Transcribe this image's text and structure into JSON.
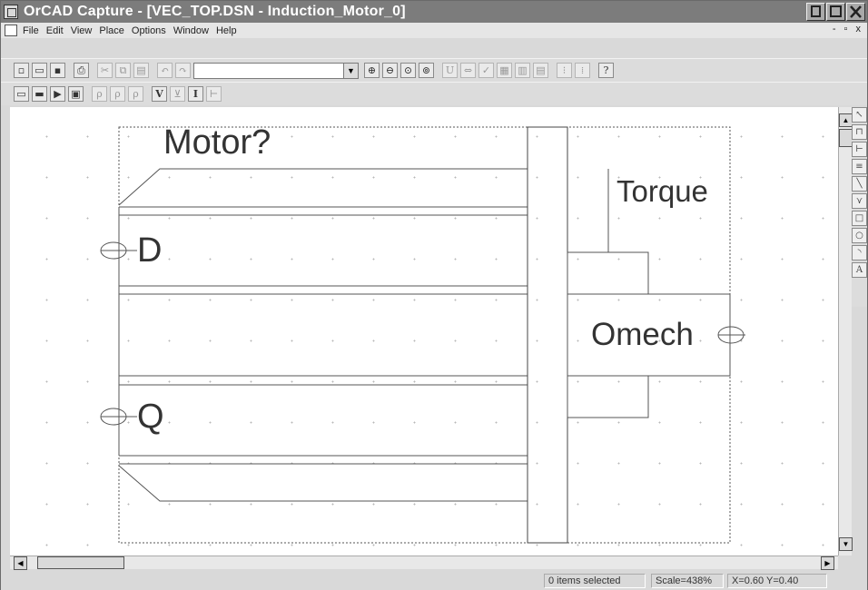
{
  "window": {
    "title": "OrCAD Capture - [VEC_TOP.DSN - Induction_Motor_0]",
    "mdi_controls": "- ▫ x"
  },
  "menu": {
    "items": [
      "File",
      "Edit",
      "View",
      "Place",
      "Options",
      "Window",
      "Help"
    ]
  },
  "toolbar1": {
    "combo_value": "",
    "icons": [
      "new-icon",
      "open-icon",
      "save-icon",
      "print-icon",
      "cut-icon",
      "copy-icon",
      "paste-icon",
      "undo-icon",
      "redo-icon",
      "zoom-in-icon",
      "zoom-out-icon",
      "zoom-area-icon",
      "zoom-all-icon",
      "annotate-icon",
      "cross-ref-icon",
      "drc-icon",
      "netlist-icon",
      "bom-icon",
      "snap-icon",
      "grid-icon",
      "help-icon"
    ]
  },
  "toolbar2": {
    "icons": [
      "schematic-icon",
      "page-icon",
      "run-icon",
      "probe-icon",
      "markers-icon",
      "markers2-icon",
      "markers3-icon"
    ],
    "text_icons": [
      "V",
      "I"
    ]
  },
  "schematic": {
    "title": "Motor?",
    "pins": {
      "d": "D",
      "q": "Q",
      "torque": "Torque",
      "omech": "Omech"
    }
  },
  "palette": {
    "icons": [
      "select-icon",
      "part-icon",
      "wire-icon",
      "net-icon",
      "line-icon",
      "polyline-icon",
      "rectangle-icon",
      "ellipse-icon",
      "arc-icon",
      "text-icon"
    ],
    "text_icon_label": "A"
  },
  "status": {
    "selection": "0 items selected",
    "scale": "Scale=438%",
    "coords": "X=0.60  Y=0.40"
  },
  "colors": {
    "titlebar": "#7c7c7c",
    "canvas": "#ffffff",
    "line": "#555555"
  }
}
